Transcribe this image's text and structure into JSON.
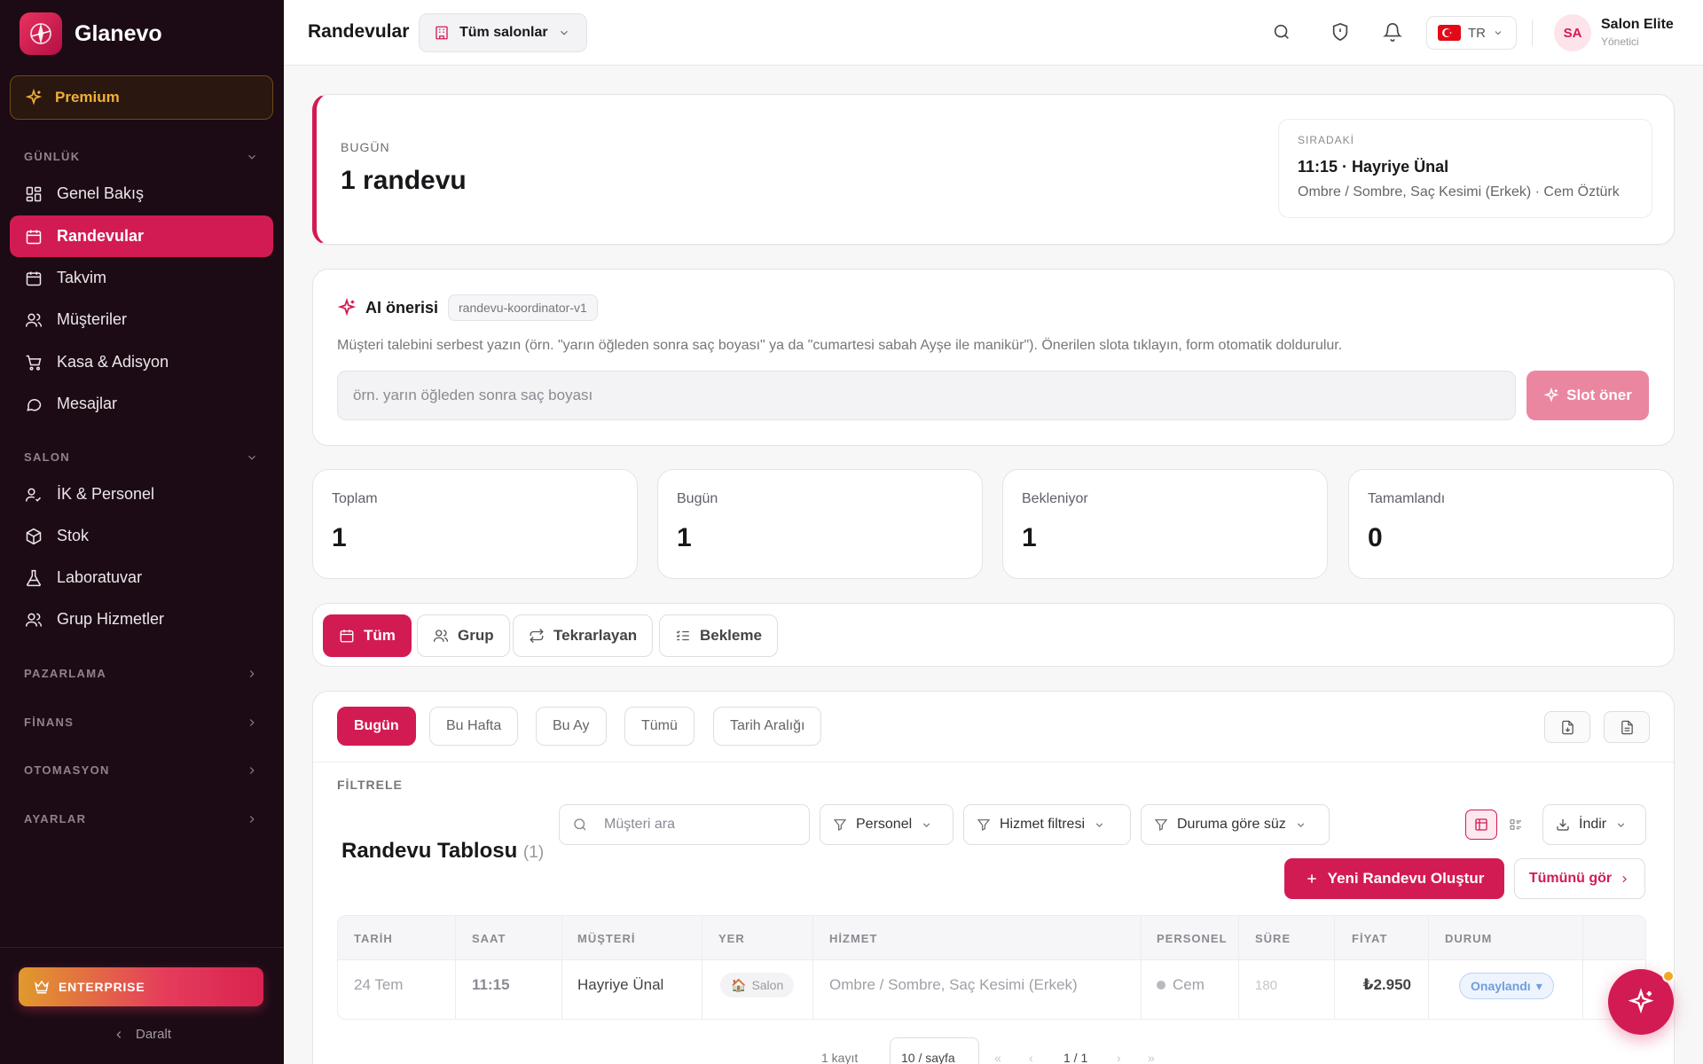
{
  "app": {
    "name": "Glanevo"
  },
  "sidebar": {
    "premium": "Premium",
    "sections": [
      {
        "label": "GÜNLÜK"
      },
      {
        "label": "SALON"
      },
      {
        "label": "PAZARLAMA"
      },
      {
        "label": "FİNANS"
      },
      {
        "label": "OTOMASYON"
      },
      {
        "label": "AYARLAR"
      }
    ],
    "items": [
      {
        "label": "Genel Bakış",
        "icon": "dashboard-icon"
      },
      {
        "label": "Randevular",
        "icon": "calendar-icon",
        "active": true
      },
      {
        "label": "Takvim",
        "icon": "calendar-grid-icon"
      },
      {
        "label": "Müşteriler",
        "icon": "users-icon"
      },
      {
        "label": "Kasa & Adisyon",
        "icon": "cart-icon"
      },
      {
        "label": "Mesajlar",
        "icon": "message-icon"
      },
      {
        "label": "İK & Personel",
        "icon": "user-check-icon"
      },
      {
        "label": "Stok",
        "icon": "box-icon"
      },
      {
        "label": "Laboratuvar",
        "icon": "flask-icon"
      },
      {
        "label": "Grup Hizmetler",
        "icon": "group-icon"
      }
    ],
    "enterprise": "ENTERPRISE",
    "collapse": "Daralt"
  },
  "topbar": {
    "title": "Randevular",
    "salon_select": "Tüm salonlar",
    "lang": "TR",
    "user_initials": "SA",
    "user_name": "Salon Elite",
    "user_role": "Yönetici"
  },
  "today": {
    "label": "BUGÜN",
    "value": "1 randevu",
    "next_label": "SIRADAKİ",
    "next_title": "11:15 · Hayriye Ünal",
    "next_detail": "Ombre / Sombre, Saç Kesimi (Erkek) · Cem Öztürk"
  },
  "ai": {
    "title": "AI önerisi",
    "badge": "randevu-koordinator-v1",
    "description": "Müşteri talebini serbest yazın (örn. \"yarın öğleden sonra saç boyası\" ya da \"cumartesi sabah Ayşe ile manikür\"). Önerilen slota tıklayın, form otomatik doldurulur.",
    "placeholder": "örn. yarın öğleden sonra saç boyası",
    "button": "Slot öner"
  },
  "stats": [
    {
      "label": "Toplam",
      "value": "1"
    },
    {
      "label": "Bugün",
      "value": "1"
    },
    {
      "label": "Bekleniyor",
      "value": "1"
    },
    {
      "label": "Tamamlandı",
      "value": "0"
    }
  ],
  "tabs": [
    {
      "label": "Tüm",
      "active": true
    },
    {
      "label": "Grup"
    },
    {
      "label": "Tekrarlayan"
    },
    {
      "label": "Bekleme"
    }
  ],
  "periods": [
    {
      "label": "Bugün",
      "active": true
    },
    {
      "label": "Bu Hafta"
    },
    {
      "label": "Bu Ay"
    },
    {
      "label": "Tümü"
    },
    {
      "label": "Tarih Aralığı"
    }
  ],
  "filter": {
    "label": "FİLTRELE",
    "search_placeholder": "Müşteri ara",
    "staff": "Personel",
    "service": "Hizmet filtresi",
    "status": "Duruma göre süz",
    "download": "İndir"
  },
  "table": {
    "title": "Randevu Tablosu",
    "count": "(1)",
    "new_button": "Yeni Randevu Oluştur",
    "all_button": "Tümünü gör",
    "columns": [
      "TARİH",
      "SAAT",
      "MÜŞTERİ",
      "YER",
      "HİZMET",
      "PERSONEL",
      "SÜRE",
      "FİYAT",
      "DURUM"
    ],
    "rows": [
      {
        "date": "24 Tem",
        "time": "11:15",
        "customer": "Hayriye Ünal",
        "place": "Salon",
        "service": "Ombre / Sombre, Saç Kesimi (Erkek)",
        "staff": "Cem",
        "duration": "180",
        "price": "₺2.950",
        "status": "Onaylandı"
      }
    ]
  },
  "pager": {
    "records": "1 kayıt",
    "page_size": "10 / sayfa",
    "page": "1 / 1"
  },
  "colors": {
    "accent": "#d31b53",
    "sidebar_bg": "#1c0b15",
    "premium": "#f0b035",
    "status_blue": "#6f9de0"
  }
}
